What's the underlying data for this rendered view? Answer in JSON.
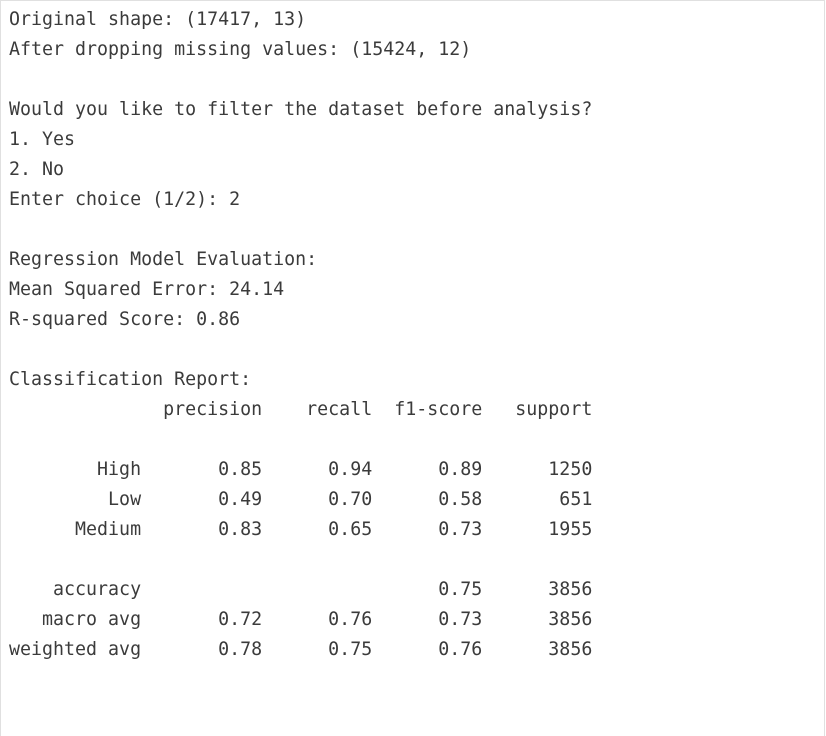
{
  "output": {
    "lines": [
      "Original shape: (17417, 13)",
      "After dropping missing values: (15424, 12)",
      "",
      "Would you like to filter the dataset before analysis?",
      "1. Yes",
      "2. No",
      "Enter choice (1/2): 2",
      "",
      "Regression Model Evaluation:",
      "Mean Squared Error: 24.14",
      "R-squared Score: 0.86",
      "",
      "Classification Report:",
      "              precision    recall  f1-score   support",
      "",
      "        High       0.85      0.94      0.89      1250",
      "         Low       0.49      0.70      0.58       651",
      "      Medium       0.83      0.65      0.73      1955",
      "",
      "    accuracy                           0.75      3856",
      "   macro avg       0.72      0.76      0.73      3856",
      "weighted avg       0.78      0.75      0.76      3856"
    ]
  }
}
